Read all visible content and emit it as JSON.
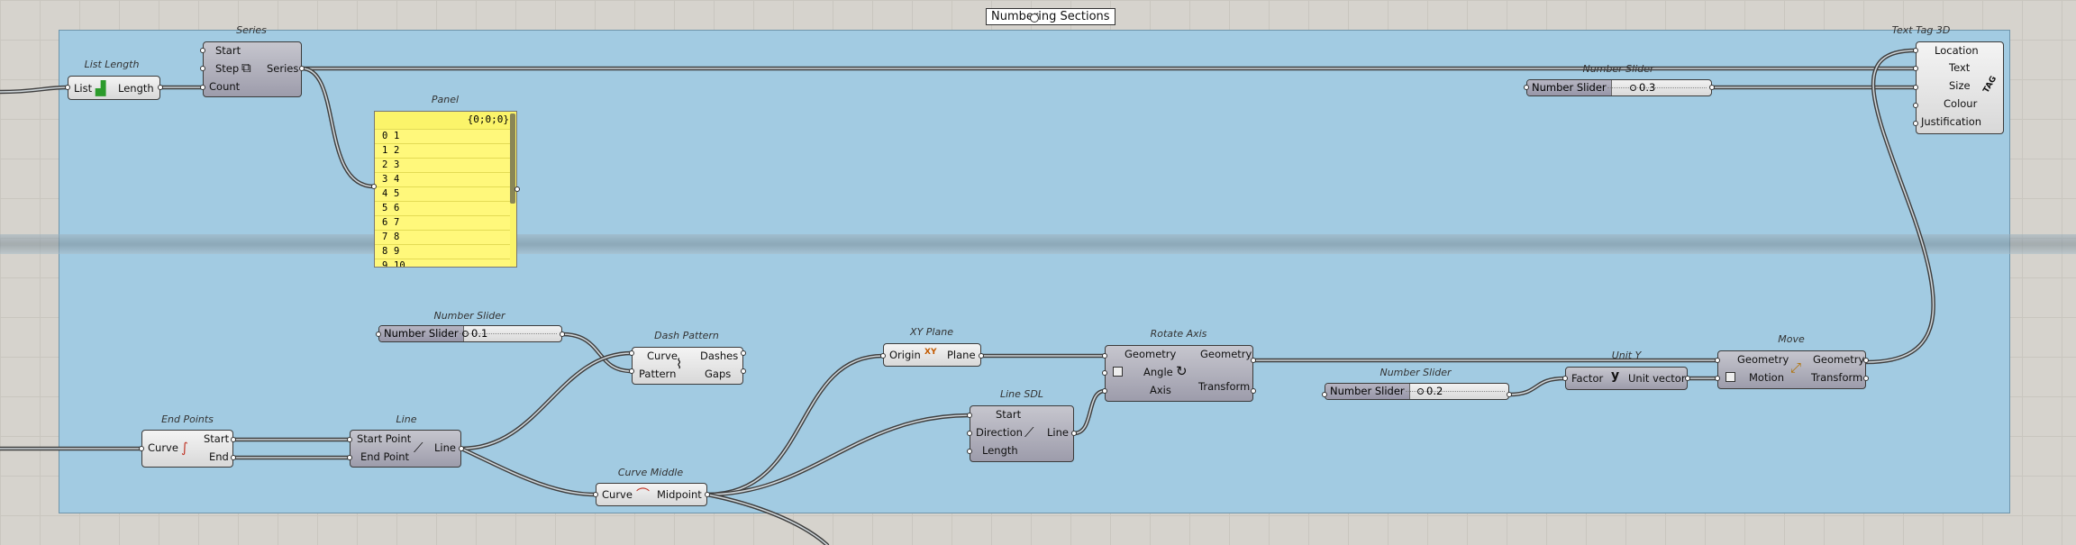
{
  "group": {
    "label": "Numbering Sections"
  },
  "list_length": {
    "title": "List Length",
    "input": "List",
    "output": "Length"
  },
  "series": {
    "title": "Series",
    "inputs": [
      "Start",
      "Step",
      "Count"
    ],
    "output": "Series"
  },
  "panel": {
    "title": "Panel",
    "header": "{0;0;0}",
    "rows": [
      {
        "i": "0",
        "v": "1"
      },
      {
        "i": "1",
        "v": "2"
      },
      {
        "i": "2",
        "v": "3"
      },
      {
        "i": "3",
        "v": "4"
      },
      {
        "i": "4",
        "v": "5"
      },
      {
        "i": "5",
        "v": "6"
      },
      {
        "i": "6",
        "v": "7"
      },
      {
        "i": "7",
        "v": "8"
      },
      {
        "i": "8",
        "v": "9"
      },
      {
        "i": "9",
        "v": "10"
      }
    ]
  },
  "slider_top": {
    "title": "Number Slider",
    "name": "Number Slider",
    "value": "0.3"
  },
  "slider_dash": {
    "title": "Number Slider",
    "name": "Number Slider",
    "value": "0.1"
  },
  "slider_bottom": {
    "title": "Number Slider",
    "name": "Number Slider",
    "value": "0.2"
  },
  "text_tag": {
    "title": "Text Tag 3D",
    "inputs": [
      "Location",
      "Text",
      "Size",
      "Colour",
      "Justification"
    ],
    "icon_text": "TAG"
  },
  "dash_pattern": {
    "title": "Dash Pattern",
    "inputs": [
      "Curve",
      "Pattern"
    ],
    "outputs": [
      "Dashes",
      "Gaps"
    ]
  },
  "xy_plane": {
    "title": "XY Plane",
    "input": "Origin",
    "output": "Plane",
    "icon_text": "XY"
  },
  "rotate_axis": {
    "title": "Rotate Axis",
    "inputs": [
      "Geometry",
      "Angle",
      "Axis"
    ],
    "outputs": [
      "Geometry",
      "Transform"
    ]
  },
  "unit_y": {
    "title": "Unit Y",
    "input": "Factor",
    "output": "Unit vector",
    "icon_text": "y"
  },
  "move": {
    "title": "Move",
    "inputs": [
      "Geometry",
      "Motion"
    ],
    "outputs": [
      "Geometry",
      "Transform"
    ]
  },
  "end_points": {
    "title": "End Points",
    "input": "Curve",
    "outputs": [
      "Start",
      "End"
    ]
  },
  "line": {
    "title": "Line",
    "inputs": [
      "Start Point",
      "End Point"
    ],
    "output": "Line"
  },
  "line_sdl": {
    "title": "Line SDL",
    "inputs": [
      "Start",
      "Direction",
      "Length"
    ],
    "output": "Line"
  },
  "curve_middle": {
    "title": "Curve Middle",
    "input": "Curve",
    "output": "Midpoint"
  },
  "colors": {
    "group_fill": "#a2cbe2",
    "canvas": "#d6d3cd",
    "panel_fill": "#fbf46a",
    "wire": "#3f3f3f"
  }
}
